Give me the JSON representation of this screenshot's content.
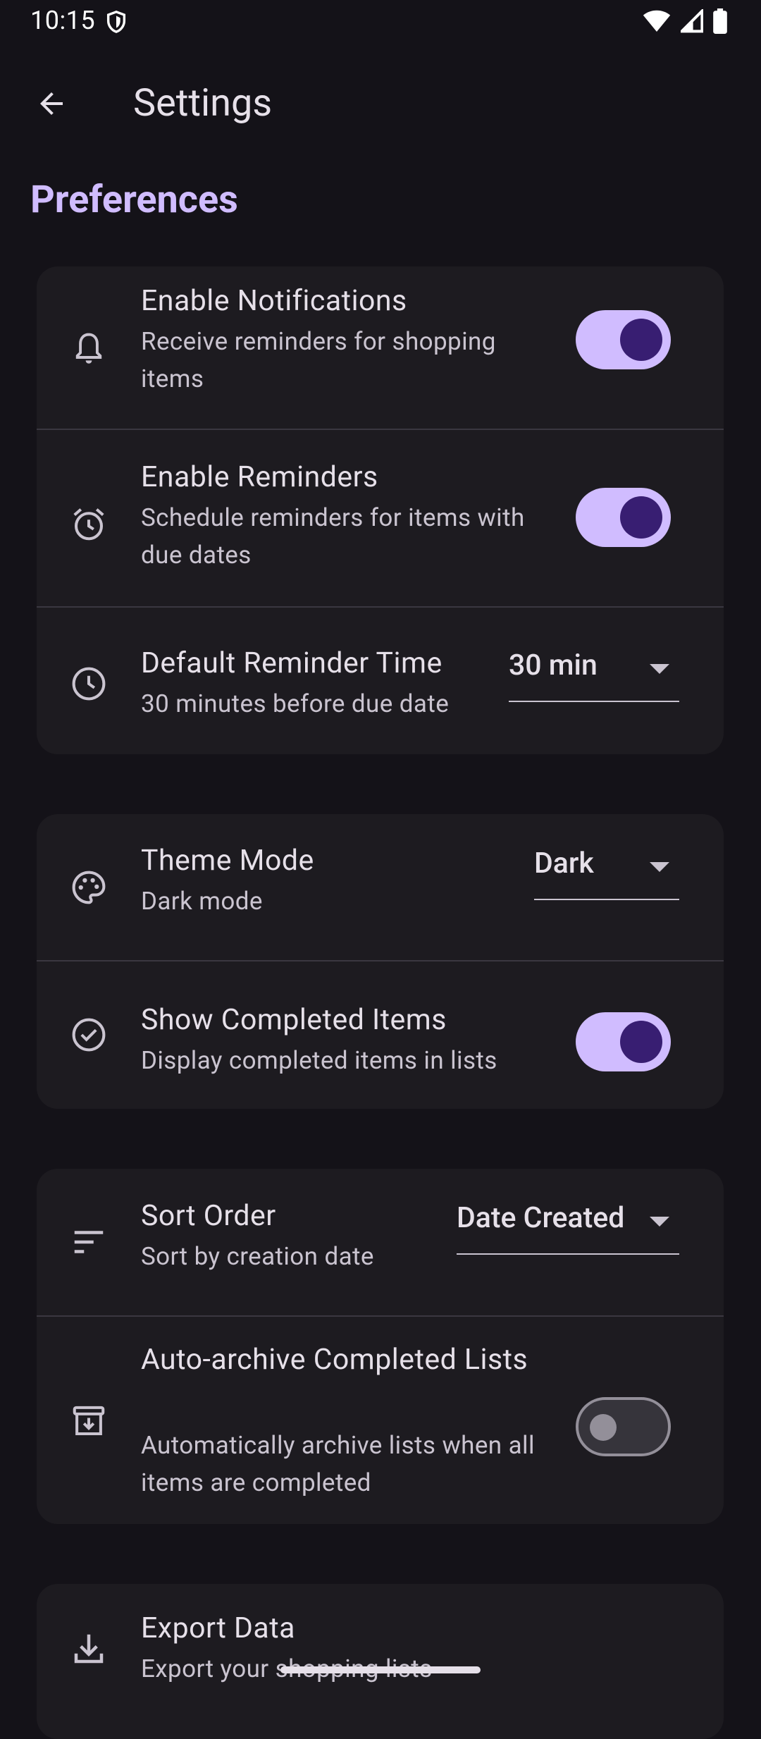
{
  "status": {
    "time": "10:15"
  },
  "appbar": {
    "title": "Settings"
  },
  "section": {
    "title": "Preferences"
  },
  "settings": {
    "notifications": {
      "title": "Enable Notifications",
      "subtitle": "Receive reminders for shopping items",
      "icon": "bell-icon",
      "enabled": true
    },
    "reminders": {
      "title": "Enable Reminders",
      "subtitle": "Schedule reminders for items with due dates",
      "icon": "alarm-icon",
      "enabled": true
    },
    "reminder_time": {
      "title": "Default Reminder Time",
      "subtitle": "30 minutes before due date",
      "icon": "clock-icon",
      "value": "30 min"
    },
    "theme": {
      "title": "Theme Mode",
      "subtitle": "Dark mode",
      "icon": "palette-icon",
      "value": "Dark"
    },
    "show_completed": {
      "title": "Show Completed Items",
      "subtitle": "Display completed items in lists",
      "icon": "check-circle-icon",
      "enabled": true
    },
    "sort": {
      "title": "Sort Order",
      "subtitle": "Sort by creation date",
      "icon": "sort-icon",
      "value": "Date Created"
    },
    "auto_archive": {
      "title": "Auto-archive Completed Lists",
      "subtitle": "Automatically archive lists when all items are completed",
      "icon": "archive-icon",
      "enabled": false
    },
    "export": {
      "title": "Export Data",
      "subtitle": "Export your shopping lists",
      "icon": "download-icon"
    }
  },
  "colors": {
    "background": "#141218",
    "card": "#1d1b20",
    "accent": "#d0bcff",
    "accent_dark": "#381e72"
  }
}
